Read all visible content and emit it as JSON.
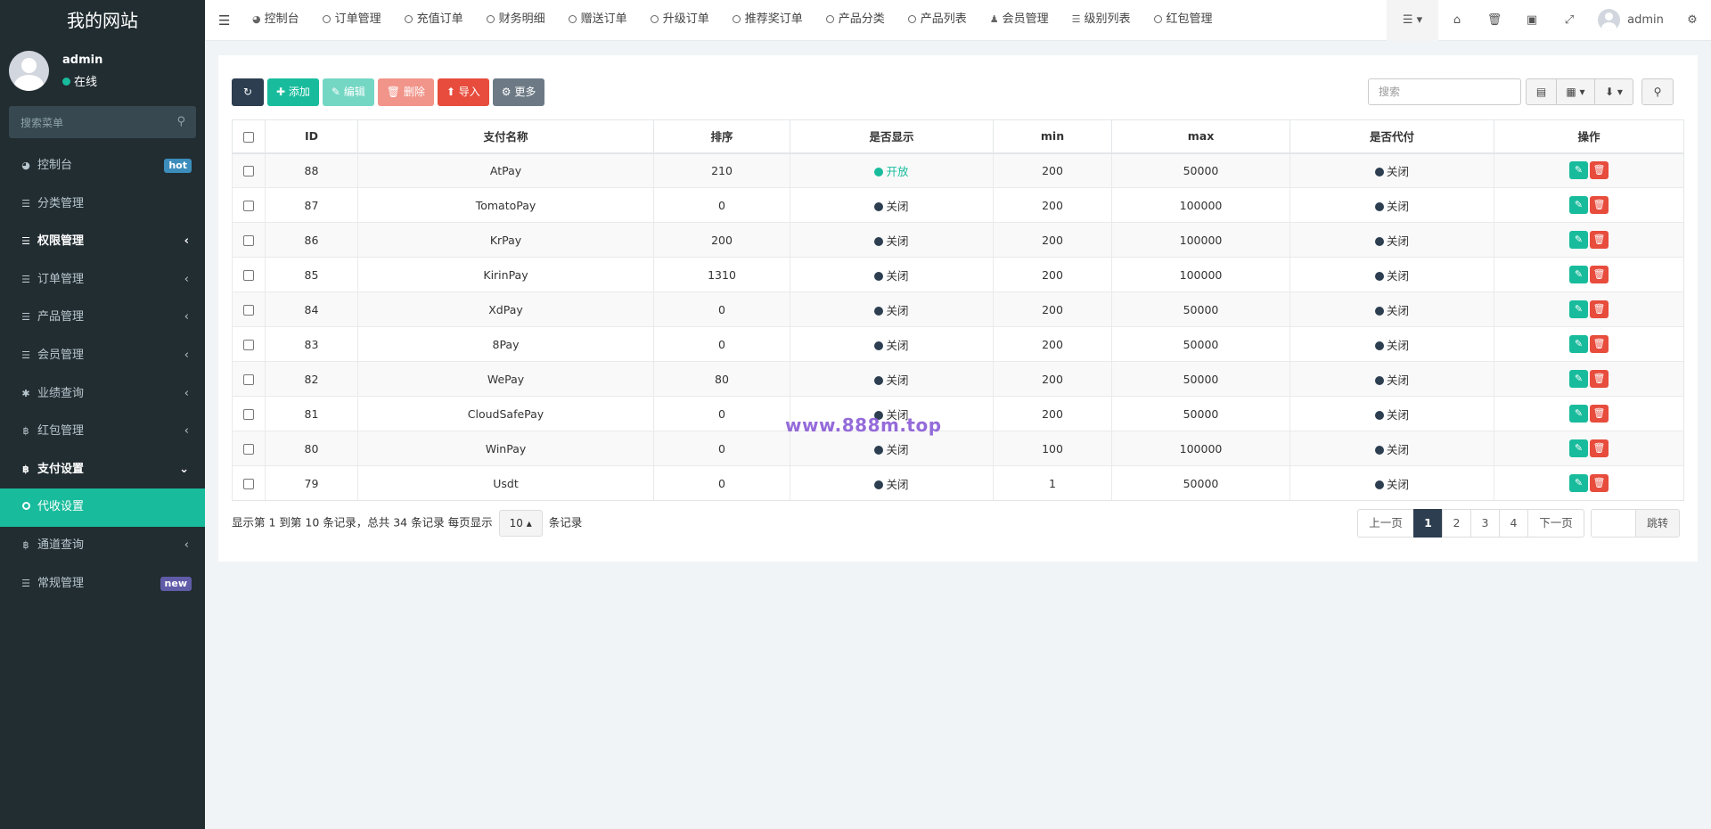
{
  "sidebar": {
    "logo": "我的网站",
    "user": {
      "name": "admin",
      "status": "在线"
    },
    "search_placeholder": "搜索菜单",
    "items": [
      {
        "label": "控制台",
        "icon": "dashboard-icon",
        "badge": "hot"
      },
      {
        "label": "分类管理",
        "icon": "list-icon"
      },
      {
        "label": "权限管理",
        "icon": "list-icon",
        "arrow": "‹"
      },
      {
        "label": "订单管理",
        "icon": "list-icon",
        "arrow": "‹"
      },
      {
        "label": "产品管理",
        "icon": "list-icon",
        "arrow": "‹"
      },
      {
        "label": "会员管理",
        "icon": "list-icon",
        "arrow": "‹"
      },
      {
        "label": "业绩查询",
        "icon": "asterisk-icon",
        "arrow": "‹"
      },
      {
        "label": "红包管理",
        "icon": "bitcoin-icon",
        "arrow": "‹"
      },
      {
        "label": "支付设置",
        "icon": "bitcoin-icon",
        "arrow": "⌄"
      },
      {
        "label": "代收设置",
        "icon": "circle-icon"
      },
      {
        "label": "通道查询",
        "icon": "bitcoin-icon",
        "arrow": "‹"
      },
      {
        "label": "常规管理",
        "icon": "list-icon",
        "badge": "new"
      }
    ]
  },
  "topnav": {
    "tabs": [
      "控制台",
      "订单管理",
      "充值订单",
      "财务明细",
      "赠送订单",
      "升级订单",
      "推荐奖订单",
      "产品分类",
      "产品列表",
      "会员管理",
      "级别列表",
      "红包管理"
    ],
    "user": "admin"
  },
  "toolbar": {
    "add": "添加",
    "edit": "编辑",
    "delete": "删除",
    "import": "导入",
    "more": "更多",
    "search_placeholder": "搜索"
  },
  "table": {
    "headers": [
      "ID",
      "支付名称",
      "排序",
      "是否显示",
      "min",
      "max",
      "是否代付",
      "操作"
    ],
    "rows": [
      {
        "id": "88",
        "name": "AtPay",
        "sort": "210",
        "show": "开放",
        "min": "200",
        "max": "50000",
        "payout": "关闭"
      },
      {
        "id": "87",
        "name": "TomatoPay",
        "sort": "0",
        "show": "关闭",
        "min": "200",
        "max": "100000",
        "payout": "关闭"
      },
      {
        "id": "86",
        "name": "KrPay",
        "sort": "200",
        "show": "关闭",
        "min": "200",
        "max": "100000",
        "payout": "关闭"
      },
      {
        "id": "85",
        "name": "KirinPay",
        "sort": "1310",
        "show": "关闭",
        "min": "200",
        "max": "100000",
        "payout": "关闭"
      },
      {
        "id": "84",
        "name": "XdPay",
        "sort": "0",
        "show": "关闭",
        "min": "200",
        "max": "50000",
        "payout": "关闭"
      },
      {
        "id": "83",
        "name": "8Pay",
        "sort": "0",
        "show": "关闭",
        "min": "200",
        "max": "50000",
        "payout": "关闭"
      },
      {
        "id": "82",
        "name": "WePay",
        "sort": "80",
        "show": "关闭",
        "min": "200",
        "max": "50000",
        "payout": "关闭"
      },
      {
        "id": "81",
        "name": "CloudSafePay",
        "sort": "0",
        "show": "关闭",
        "min": "200",
        "max": "50000",
        "payout": "关闭"
      },
      {
        "id": "80",
        "name": "WinPay",
        "sort": "0",
        "show": "关闭",
        "min": "100",
        "max": "100000",
        "payout": "关闭"
      },
      {
        "id": "79",
        "name": "Usdt",
        "sort": "0",
        "show": "关闭",
        "min": "1",
        "max": "50000",
        "payout": "关闭"
      }
    ]
  },
  "pager": {
    "info_prefix": "显示第 1 到第 10 条记录，总共 34 条记录 每页显示",
    "page_size": "10",
    "info_suffix": "条记录",
    "prev": "上一页",
    "pages": [
      "1",
      "2",
      "3",
      "4"
    ],
    "next": "下一页",
    "jump": "跳转"
  },
  "watermark": "www.888m.top",
  "colors": {
    "accent": "#18bc9c",
    "dark": "#2c3e50",
    "danger": "#e74c3c",
    "sidebar": "#222d32"
  }
}
